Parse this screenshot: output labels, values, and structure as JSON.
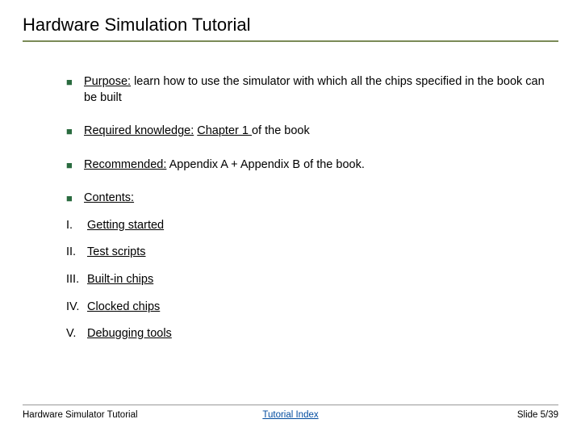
{
  "title": "Hardware Simulation Tutorial",
  "bullets": {
    "purpose_label": "Purpose:",
    "purpose_text": " learn how to use the simulator with which all the chips specified in the book can be built",
    "required_label": "Required knowledge:",
    "required_link": "Chapter 1 ",
    "required_rest": "of the book",
    "recommended_label": "Recommended:",
    "recommended_text": " Appendix A + Appendix B of the book.",
    "contents_label": "Contents:"
  },
  "contents": [
    {
      "roman": "I.",
      "text": "Getting started"
    },
    {
      "roman": "II.",
      "text": "Test scripts"
    },
    {
      "roman": "III.",
      "text": "Built-in chips"
    },
    {
      "roman": "IV.",
      "text": "Clocked chips"
    },
    {
      "roman": "V.",
      "text": "Debugging tools"
    }
  ],
  "footer": {
    "left": "Hardware Simulator Tutorial",
    "center": "Tutorial Index",
    "right": "Slide 5/39"
  }
}
